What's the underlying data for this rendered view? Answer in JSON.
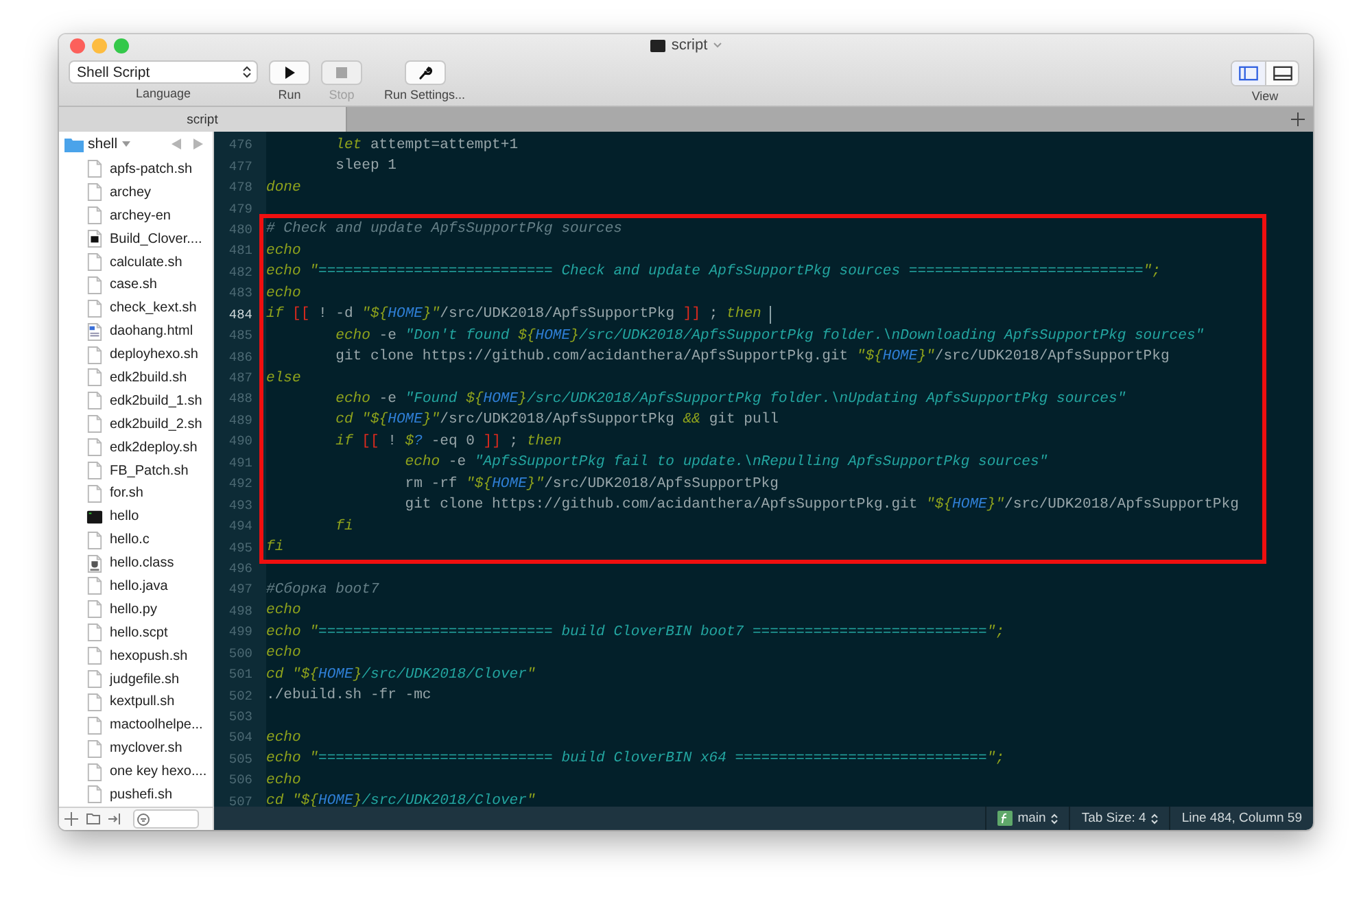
{
  "window": {
    "title": "script"
  },
  "toolbar": {
    "language": {
      "value": "Shell Script",
      "label": "Language"
    },
    "buttons": [
      {
        "kind": "run",
        "label": "Run",
        "disabled": false
      },
      {
        "kind": "stop",
        "label": "Stop",
        "disabled": true
      },
      {
        "kind": "settings",
        "label": "Run Settings...",
        "disabled": false
      }
    ],
    "view": {
      "label": "View",
      "segments": [
        {
          "kind": "sidebar",
          "selected": true
        },
        {
          "kind": "console",
          "selected": false
        }
      ]
    }
  },
  "tabs": [
    {
      "label": "script",
      "selected": true
    }
  ],
  "sidebar": {
    "folder": "shell",
    "files": [
      {
        "name": "apfs-patch.sh",
        "kind": "doc"
      },
      {
        "name": "archey",
        "kind": "doc"
      },
      {
        "name": "archey-en",
        "kind": "doc"
      },
      {
        "name": "Build_Clover....",
        "kind": "exec"
      },
      {
        "name": "calculate.sh",
        "kind": "doc"
      },
      {
        "name": "case.sh",
        "kind": "doc"
      },
      {
        "name": "check_kext.sh",
        "kind": "doc"
      },
      {
        "name": "daohang.html",
        "kind": "html"
      },
      {
        "name": "deployhexo.sh",
        "kind": "doc"
      },
      {
        "name": "edk2build.sh",
        "kind": "doc"
      },
      {
        "name": "edk2build_1.sh",
        "kind": "doc"
      },
      {
        "name": "edk2build_2.sh",
        "kind": "doc"
      },
      {
        "name": "edk2deploy.sh",
        "kind": "doc"
      },
      {
        "name": "FB_Patch.sh",
        "kind": "doc"
      },
      {
        "name": "for.sh",
        "kind": "doc"
      },
      {
        "name": "hello",
        "kind": "terminal"
      },
      {
        "name": "hello.c",
        "kind": "doc"
      },
      {
        "name": "hello.class",
        "kind": "class"
      },
      {
        "name": "hello.java",
        "kind": "doc"
      },
      {
        "name": "hello.py",
        "kind": "doc"
      },
      {
        "name": "hello.scpt",
        "kind": "doc"
      },
      {
        "name": "hexopush.sh",
        "kind": "doc"
      },
      {
        "name": "judgefile.sh",
        "kind": "doc"
      },
      {
        "name": "kextpull.sh",
        "kind": "doc"
      },
      {
        "name": "mactoolhelpe...",
        "kind": "doc"
      },
      {
        "name": "myclover.sh",
        "kind": "doc"
      },
      {
        "name": "one key hexo....",
        "kind": "doc"
      },
      {
        "name": "pushefi.sh",
        "kind": "doc"
      }
    ]
  },
  "editor": {
    "blocks": [
      {
        "annotated": false,
        "lines": [
          {
            "number": "476",
            "current": false,
            "tokens": [
              {
                "kind": "kw",
                "text": "        let"
              },
              {
                "kind": "plain",
                "text": " attempt=attempt+1"
              }
            ]
          },
          {
            "number": "477",
            "current": false,
            "tokens": [
              {
                "kind": "plain",
                "text": "        sleep 1"
              }
            ]
          },
          {
            "number": "478",
            "current": false,
            "tokens": [
              {
                "kind": "kw",
                "text": "done"
              }
            ]
          },
          {
            "number": "479",
            "current": false
          }
        ]
      },
      {
        "annotated": true,
        "lines": [
          {
            "number": "480",
            "current": false,
            "tokens": [
              {
                "kind": "cmt",
                "text": "# Check and update ApfsSupportPkg sources"
              }
            ]
          },
          {
            "number": "481",
            "current": false,
            "tokens": [
              {
                "kind": "kw",
                "text": "echo"
              }
            ]
          },
          {
            "number": "482",
            "current": false,
            "tokens": [
              {
                "kind": "kw",
                "text": "echo"
              },
              {
                "kind": "punct",
                "text": " \""
              },
              {
                "kind": "str",
                "text": "=========================== Check and update ApfsSupportPkg sources ==========================="
              },
              {
                "kind": "punct",
                "text": "\";"
              }
            ]
          },
          {
            "number": "483",
            "current": false,
            "tokens": [
              {
                "kind": "kw",
                "text": "echo"
              }
            ]
          },
          {
            "number": "484",
            "current": true,
            "tokens": [
              {
                "kind": "kw",
                "text": "if"
              },
              {
                "kind": "brk",
                "text": " [["
              },
              {
                "kind": "plain",
                "text": " ! -d "
              },
              {
                "kind": "punct",
                "text": "\"${"
              },
              {
                "kind": "var",
                "text": "HOME"
              },
              {
                "kind": "punct",
                "text": "}\""
              },
              {
                "kind": "plain",
                "text": "/src/UDK2018/ApfsSupportPkg "
              },
              {
                "kind": "brk",
                "text": "]]"
              },
              {
                "kind": "plain",
                "text": " ; "
              },
              {
                "kind": "kw",
                "text": "then"
              }
            ]
          },
          {
            "number": "485",
            "current": false,
            "tokens": [
              {
                "kind": "kw",
                "text": "        echo"
              },
              {
                "kind": "plain",
                "text": " -e "
              },
              {
                "kind": "str",
                "text": "\"Don't found "
              },
              {
                "kind": "punct",
                "text": "${"
              },
              {
                "kind": "var",
                "text": "HOME"
              },
              {
                "kind": "punct",
                "text": "}"
              },
              {
                "kind": "str",
                "text": "/src/UDK2018/ApfsSupportPkg folder.\\nDownloading ApfsSupportPkg sources\""
              }
            ]
          },
          {
            "number": "486",
            "current": false,
            "tokens": [
              {
                "kind": "plain",
                "text": "        git clone https://github.com/acidanthera/ApfsSupportPkg.git "
              },
              {
                "kind": "punct",
                "text": "\"${"
              },
              {
                "kind": "var",
                "text": "HOME"
              },
              {
                "kind": "punct",
                "text": "}\""
              },
              {
                "kind": "plain",
                "text": "/src/UDK2018/ApfsSupportPkg"
              }
            ]
          },
          {
            "number": "487",
            "current": false,
            "tokens": [
              {
                "kind": "kw",
                "text": "else"
              }
            ]
          },
          {
            "number": "488",
            "current": false,
            "tokens": [
              {
                "kind": "kw",
                "text": "        echo"
              },
              {
                "kind": "plain",
                "text": " -e "
              },
              {
                "kind": "str",
                "text": "\"Found "
              },
              {
                "kind": "punct",
                "text": "${"
              },
              {
                "kind": "var",
                "text": "HOME"
              },
              {
                "kind": "punct",
                "text": "}"
              },
              {
                "kind": "str",
                "text": "/src/UDK2018/ApfsSupportPkg folder.\\nUpdating ApfsSupportPkg sources\""
              }
            ]
          },
          {
            "number": "489",
            "current": false,
            "tokens": [
              {
                "kind": "kw",
                "text": "        cd"
              },
              {
                "kind": "punct",
                "text": " \"${"
              },
              {
                "kind": "var",
                "text": "HOME"
              },
              {
                "kind": "punct",
                "text": "}\""
              },
              {
                "kind": "plain",
                "text": "/src/UDK2018/ApfsSupportPkg "
              },
              {
                "kind": "punct",
                "text": "&&"
              },
              {
                "kind": "plain",
                "text": " git pull"
              }
            ]
          },
          {
            "number": "490",
            "current": false,
            "tokens": [
              {
                "kind": "kw",
                "text": "        if"
              },
              {
                "kind": "brk",
                "text": " [["
              },
              {
                "kind": "plain",
                "text": " ! "
              },
              {
                "kind": "punct",
                "text": "$"
              },
              {
                "kind": "var",
                "text": "?"
              },
              {
                "kind": "plain",
                "text": " -eq 0 "
              },
              {
                "kind": "brk",
                "text": "]]"
              },
              {
                "kind": "plain",
                "text": " ; "
              },
              {
                "kind": "kw",
                "text": "then"
              }
            ]
          },
          {
            "number": "491",
            "current": false,
            "tokens": [
              {
                "kind": "kw",
                "text": "                echo"
              },
              {
                "kind": "plain",
                "text": " -e "
              },
              {
                "kind": "str",
                "text": "\"ApfsSupportPkg fail to update.\\nRepulling ApfsSupportPkg sources\""
              }
            ]
          },
          {
            "number": "492",
            "current": false,
            "tokens": [
              {
                "kind": "plain",
                "text": "                rm -rf "
              },
              {
                "kind": "punct",
                "text": "\"${"
              },
              {
                "kind": "var",
                "text": "HOME"
              },
              {
                "kind": "punct",
                "text": "}\""
              },
              {
                "kind": "plain",
                "text": "/src/UDK2018/ApfsSupportPkg"
              }
            ]
          },
          {
            "number": "493",
            "current": false,
            "tokens": [
              {
                "kind": "plain",
                "text": "                git clone https://github.com/acidanthera/ApfsSupportPkg.git "
              },
              {
                "kind": "punct",
                "text": "\"${"
              },
              {
                "kind": "var",
                "text": "HOME"
              },
              {
                "kind": "punct",
                "text": "}\""
              },
              {
                "kind": "plain",
                "text": "/src/UDK2018/ApfsSupportPkg"
              }
            ]
          },
          {
            "number": "494",
            "current": false,
            "tokens": [
              {
                "kind": "kw",
                "text": "        fi"
              }
            ]
          },
          {
            "number": "495",
            "current": false,
            "tokens": [
              {
                "kind": "kw",
                "text": "fi"
              }
            ]
          }
        ]
      },
      {
        "annotated": false,
        "lines": [
          {
            "number": "496",
            "current": false
          },
          {
            "number": "497",
            "current": false,
            "tokens": [
              {
                "kind": "cmt",
                "text": "#Сборка boot7"
              }
            ]
          },
          {
            "number": "498",
            "current": false,
            "tokens": [
              {
                "kind": "kw",
                "text": "echo"
              }
            ]
          },
          {
            "number": "499",
            "current": false,
            "tokens": [
              {
                "kind": "kw",
                "text": "echo"
              },
              {
                "kind": "punct",
                "text": " \""
              },
              {
                "kind": "str",
                "text": "=========================== build CloverBIN boot7 ==========================="
              },
              {
                "kind": "punct",
                "text": "\";"
              }
            ]
          },
          {
            "number": "500",
            "current": false,
            "tokens": [
              {
                "kind": "kw",
                "text": "echo"
              }
            ]
          },
          {
            "number": "501",
            "current": false,
            "tokens": [
              {
                "kind": "kw",
                "text": "cd"
              },
              {
                "kind": "punct",
                "text": " \"${"
              },
              {
                "kind": "var",
                "text": "HOME"
              },
              {
                "kind": "punct",
                "text": "}"
              },
              {
                "kind": "str",
                "text": "/src/UDK2018/Clover"
              },
              {
                "kind": "punct",
                "text": "\""
              }
            ]
          },
          {
            "number": "502",
            "current": false,
            "tokens": [
              {
                "kind": "plain",
                "text": "./ebuild.sh -fr -mc"
              }
            ]
          },
          {
            "number": "503",
            "current": false
          },
          {
            "number": "504",
            "current": false,
            "tokens": [
              {
                "kind": "kw",
                "text": "echo"
              }
            ]
          },
          {
            "number": "505",
            "current": false,
            "tokens": [
              {
                "kind": "kw",
                "text": "echo"
              },
              {
                "kind": "punct",
                "text": " \""
              },
              {
                "kind": "str",
                "text": "=========================== build CloverBIN x64 ============================="
              },
              {
                "kind": "punct",
                "text": "\";"
              }
            ]
          },
          {
            "number": "506",
            "current": false,
            "tokens": [
              {
                "kind": "kw",
                "text": "echo"
              }
            ]
          },
          {
            "number": "507",
            "current": false,
            "tokens": [
              {
                "kind": "kw",
                "text": "cd"
              },
              {
                "kind": "punct",
                "text": " \"${"
              },
              {
                "kind": "var",
                "text": "HOME"
              },
              {
                "kind": "punct",
                "text": "}"
              },
              {
                "kind": "str",
                "text": "/src/UDK2018/Clover"
              },
              {
                "kind": "punct",
                "text": "\""
              }
            ]
          }
        ]
      }
    ]
  },
  "status_bar": {
    "function": "main",
    "tab_size": "Tab Size: 4",
    "position": "Line 484, Column 59"
  }
}
